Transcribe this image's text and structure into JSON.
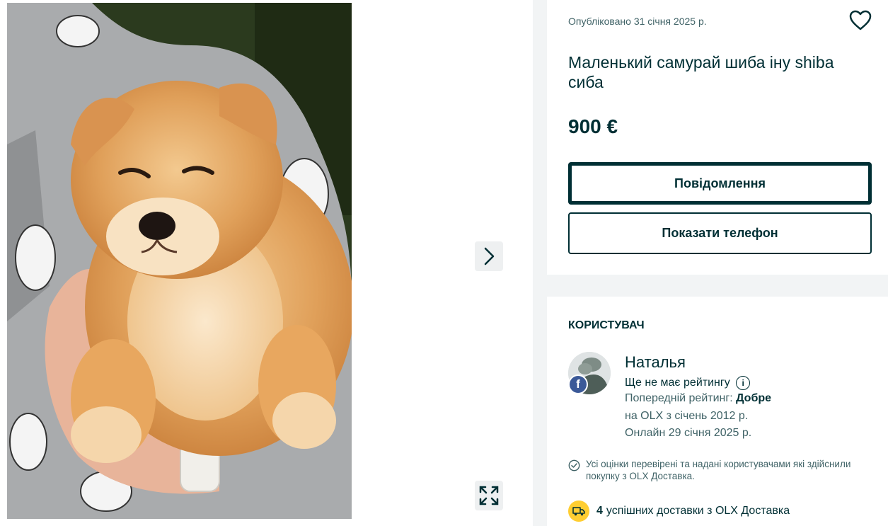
{
  "gallery": {
    "photo_alt": "",
    "icons": {
      "next": "chevron-right-icon",
      "fullscreen": "expand-icon"
    }
  },
  "ad": {
    "published": "Опубліковано 31 січня 2025 р.",
    "title": "Маленький самурай шиба іну shiba сиба",
    "price": "900 €",
    "message_button": "Повідомлення",
    "phone_button": "Показати телефон",
    "favorite_icon": "heart-icon"
  },
  "user": {
    "section_title": "КОРИСТУВАЧ",
    "name": "Наталья",
    "no_rating": "Ще не має рейтингу",
    "prev_rating_label": "Попередній рейтинг: ",
    "prev_rating_value": "Добре",
    "since": "на OLX з січень 2012 р.",
    "online": "Онлайн 29 січня 2025 р.",
    "verified_note": "Усі оцінки перевірені та надані користувачами які здійснили покупку з OLX Доставка.",
    "delivery_count": "4",
    "delivery_text": "успішних доставки з OLX Доставка",
    "social_badge": "f"
  },
  "colors": {
    "primary": "#002f34",
    "secondary_text": "#406367",
    "sidebar_bg": "#f2f4f5",
    "delivery_badge": "#ffce32",
    "facebook": "#3b5998"
  }
}
